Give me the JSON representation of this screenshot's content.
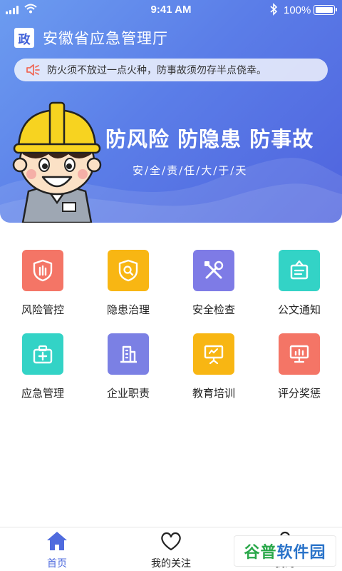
{
  "status": {
    "time": "9:41 AM",
    "battery": "100%"
  },
  "header": {
    "badge": "政",
    "title": "安徽省应急管理厅",
    "notice": "防火须不放过一点火种，防事故须勿存半点侥幸。"
  },
  "banner": {
    "slogan": "防风险  防隐患  防事故",
    "sub_slogan": "安/全/责/任/大/于/天"
  },
  "grid": [
    {
      "label": "风险管控",
      "icon": "shield-bars-icon",
      "color": "#f47566"
    },
    {
      "label": "隐患治理",
      "icon": "shield-search-icon",
      "color": "#f8b613"
    },
    {
      "label": "安全检查",
      "icon": "tools-icon",
      "color": "#7e7be6"
    },
    {
      "label": "公文通知",
      "icon": "notice-board-icon",
      "color": "#33d3c6"
    },
    {
      "label": "应急管理",
      "icon": "first-aid-kit-icon",
      "color": "#33d3c6"
    },
    {
      "label": "企业职责",
      "icon": "building-icon",
      "color": "#7b80e4"
    },
    {
      "label": "教育培训",
      "icon": "presentation-board-icon",
      "color": "#f8b613"
    },
    {
      "label": "评分奖惩",
      "icon": "score-board-icon",
      "color": "#f47566"
    }
  ],
  "tabbar": {
    "items": [
      {
        "label": "首页",
        "icon": "home-icon",
        "active": true
      },
      {
        "label": "我的关注",
        "icon": "heart-icon",
        "active": false
      },
      {
        "label": "我的",
        "icon": "user-icon",
        "active": false
      }
    ]
  },
  "watermark": {
    "part1": "谷普",
    "part2": "软件园"
  },
  "colors": {
    "accent": "#4f6bde",
    "hero_start": "#6c9cf0",
    "hero_end": "#4f63de"
  }
}
